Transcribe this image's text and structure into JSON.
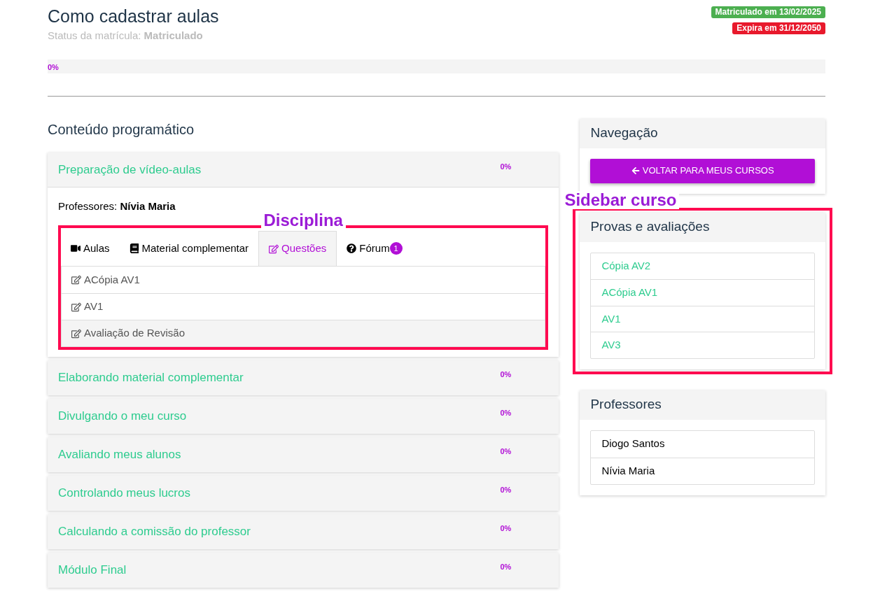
{
  "header": {
    "title": "Como cadastrar aulas",
    "status_label": "Status da matrícula:",
    "status_value": "Matriculado",
    "badges": [
      {
        "text": "Matriculado em 13/02/2025",
        "color": "#4caf50"
      },
      {
        "text": "Expira em 31/12/2050",
        "color": "#e8192c"
      }
    ],
    "progress": {
      "level": 0,
      "text": "0%"
    }
  },
  "content": {
    "title": "Conteúdo programático",
    "modules": [
      {
        "title": "Preparação de vídeo-aulas",
        "percent": "0%",
        "expanded": true,
        "teachers_label": "Professores:",
        "teachers": "Nívia Maria",
        "annotation": "Disciplina",
        "tabs": [
          {
            "label": "Aulas",
            "selected": false
          },
          {
            "label": "Material complementar",
            "selected": false
          },
          {
            "label": "Questões",
            "selected": true
          },
          {
            "label": "Fórum",
            "selected": false,
            "badge": "1"
          }
        ],
        "items": [
          {
            "label": "ACópia AV1",
            "selected": false
          },
          {
            "label": "AV1",
            "selected": false
          },
          {
            "label": "Avaliação de Revisão",
            "selected": true
          }
        ]
      },
      {
        "title": "Elaborando material complementar",
        "percent": "0%",
        "expanded": false
      },
      {
        "title": "Divulgando o meu curso",
        "percent": "0%",
        "expanded": false
      },
      {
        "title": "Avaliando meus alunos",
        "percent": "0%",
        "expanded": false
      },
      {
        "title": "Controlando meus lucros",
        "percent": "0%",
        "expanded": false
      },
      {
        "title": "Calculando a comissão do professor",
        "percent": "0%",
        "expanded": false
      },
      {
        "title": "Módulo Final",
        "percent": "0%",
        "expanded": false
      }
    ]
  },
  "sidebar": {
    "navigation": {
      "title": "Navegação",
      "button": "VOLTAR PARA MEUS CURSOS"
    },
    "exams": {
      "annotation": "Sidebar curso",
      "title": "Provas e avaliações",
      "items": [
        "Cópia AV2",
        "ACópia AV1",
        "AV1",
        "AV3"
      ]
    },
    "teachers": {
      "title": "Professores",
      "items": [
        "Diogo Santos",
        "Nívia Maria"
      ]
    }
  }
}
